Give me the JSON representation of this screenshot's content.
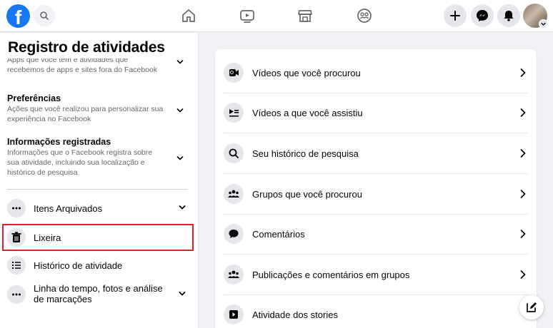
{
  "topbar": {
    "logo_letter": "f",
    "nav_icons": [
      "home-icon",
      "watch-icon",
      "marketplace-icon",
      "groups-icon"
    ],
    "right_icons": [
      "plus-icon",
      "messenger-icon",
      "bell-icon"
    ]
  },
  "sidebar": {
    "title": "Registro de atividades",
    "categories": [
      {
        "title": "",
        "desc_clipped": "Apps que você tem e atividades que",
        "desc": "recebemos de apps e sites fora do Facebook"
      },
      {
        "title": "Preferências",
        "desc": "Ações que você realizou para personalizar sua experiência no Facebook"
      },
      {
        "title": "Informações registradas",
        "desc": "Informações que o Facebook registra sobre sua atividade, incluindo sua localização e histórico de pesquisa"
      }
    ],
    "nav": [
      {
        "label": "Itens Arquivados",
        "icon": "more-icon"
      },
      {
        "label": "Lixeira",
        "icon": "trash-icon"
      },
      {
        "label": "Histórico de atividade",
        "icon": "list-icon"
      },
      {
        "label": "Linha do tempo, fotos e análise de marcações",
        "icon": "more-icon"
      }
    ]
  },
  "main": {
    "rows": [
      {
        "label": "Vídeos que você procurou",
        "icon": "video-search-icon"
      },
      {
        "label": "Vídeos a que você assistiu",
        "icon": "video-watched-icon"
      },
      {
        "label": "Seu histórico de pesquisa",
        "icon": "search-icon"
      },
      {
        "label": "Grupos que você procurou",
        "icon": "groups-icon"
      },
      {
        "label": "Comentários",
        "icon": "comment-icon"
      },
      {
        "label": "Publicações e comentários em grupos",
        "icon": "groups-icon"
      },
      {
        "label": "Atividade dos stories",
        "icon": "stories-icon"
      }
    ]
  },
  "colors": {
    "brand": "#1877f2",
    "highlight": "#e4202a"
  }
}
